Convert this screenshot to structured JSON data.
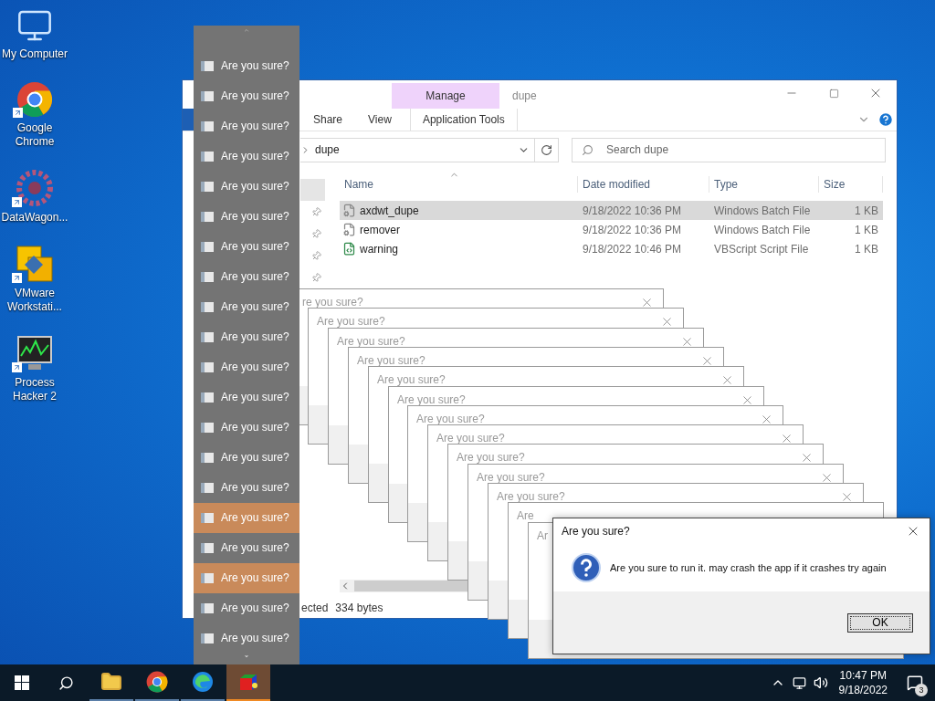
{
  "desktop_icons": [
    {
      "kind": "computer",
      "label": "My Computer",
      "shortcut": false
    },
    {
      "kind": "chrome",
      "label": "Google Chrome",
      "shortcut": true
    },
    {
      "kind": "datawagon",
      "label": "DataWagon...",
      "shortcut": true
    },
    {
      "kind": "vmware",
      "label": "VMware Workstati...",
      "shortcut": true
    },
    {
      "kind": "hacker",
      "label": "Process Hacker 2",
      "shortcut": true
    }
  ],
  "explorer": {
    "title": "dupe",
    "context_tab": "Manage",
    "ribbon_tabs": [
      {
        "kind": "file"
      },
      {
        "label": "Share",
        "kind": "tab"
      },
      {
        "label": "View",
        "kind": "tab"
      },
      {
        "label": "Application Tools",
        "kind": "context"
      }
    ],
    "address": "dupe",
    "search_placeholder": "Search dupe",
    "nav": [
      {
        "selected": true,
        "pinned": false
      },
      {
        "selected": false,
        "pinned": true
      },
      {
        "selected": false,
        "pinned": true
      },
      {
        "selected": false,
        "pinned": true
      },
      {
        "selected": false,
        "pinned": true
      }
    ],
    "columns": [
      "Name",
      "Date modified",
      "Type",
      "Size"
    ],
    "rows": [
      {
        "name": "axdwt_dupe",
        "date": "9/18/2022 10:36 PM",
        "type": "Windows Batch File",
        "size": "1 KB",
        "kind": "batch",
        "selected": true
      },
      {
        "name": "remover",
        "date": "9/18/2022 10:36 PM",
        "type": "Windows Batch File",
        "size": "1 KB",
        "kind": "batch",
        "selected": false
      },
      {
        "name": "warning",
        "date": "9/18/2022 10:46 PM",
        "type": "VBScript Script File",
        "size": "1 KB",
        "kind": "script",
        "selected": false
      }
    ],
    "status": {
      "selection": "ected",
      "bytes": "334 bytes"
    }
  },
  "dialogs_behind": [
    {
      "title": "re you sure?",
      "close": true
    },
    {
      "title": "Are you sure?",
      "close": true
    },
    {
      "title": "Are you sure?",
      "close": true
    },
    {
      "title": "Are you sure?",
      "close": true
    },
    {
      "title": "Are you sure?",
      "close": true
    },
    {
      "title": "Are you sure?",
      "close": true
    },
    {
      "title": "Are you sure?",
      "close": true
    },
    {
      "title": "Are you sure?",
      "close": true
    },
    {
      "title": "Are you sure?",
      "close": true
    },
    {
      "title": "Are you sure?",
      "close": true
    },
    {
      "title": "Are you sure?",
      "close": true
    },
    {
      "title": "Are",
      "close": false
    },
    {
      "title": "Ar",
      "close": false
    }
  ],
  "dialog": {
    "title": "Are you sure?",
    "message": "Are you sure to run it. may crash the app if it crashes try again",
    "button": "OK"
  },
  "thumbnail_list": {
    "items": [
      {
        "label": "Are you sure?",
        "selected": false
      },
      {
        "label": "Are you sure?",
        "selected": false
      },
      {
        "label": "Are you sure?",
        "selected": false
      },
      {
        "label": "Are you sure?",
        "selected": false
      },
      {
        "label": "Are you sure?",
        "selected": false
      },
      {
        "label": "Are you sure?",
        "selected": false
      },
      {
        "label": "Are you sure?",
        "selected": false
      },
      {
        "label": "Are you sure?",
        "selected": false
      },
      {
        "label": "Are you sure?",
        "selected": false
      },
      {
        "label": "Are you sure?",
        "selected": false
      },
      {
        "label": "Are you sure?",
        "selected": false
      },
      {
        "label": "Are you sure?",
        "selected": false
      },
      {
        "label": "Are you sure?",
        "selected": false
      },
      {
        "label": "Are you sure?",
        "selected": false
      },
      {
        "label": "Are you sure?",
        "selected": false
      },
      {
        "label": "Are you sure?",
        "selected": true
      },
      {
        "label": "Are you sure?",
        "selected": false
      },
      {
        "label": "Are you sure?",
        "selected": true
      },
      {
        "label": "Are you sure?",
        "selected": false
      },
      {
        "label": "Are you sure?",
        "selected": false
      }
    ]
  },
  "taskbar": {
    "apps": [
      {
        "kind": "explorer",
        "active": false
      },
      {
        "kind": "chrome",
        "active": false
      },
      {
        "kind": "edge",
        "active": false
      },
      {
        "kind": "app",
        "active": true
      }
    ],
    "time": "10:47 PM",
    "date": "9/18/2022",
    "notifications": "3"
  }
}
